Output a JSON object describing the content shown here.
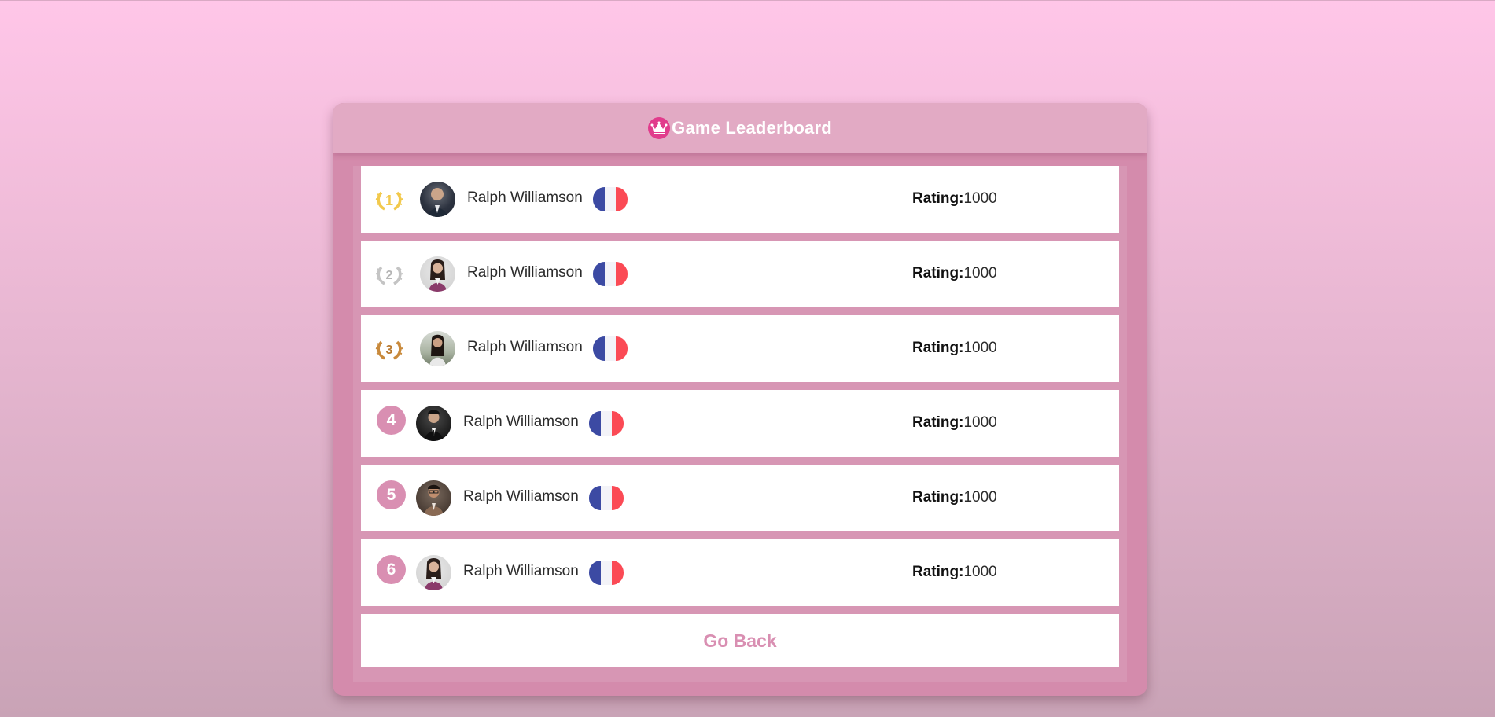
{
  "header": {
    "title": "Game Leaderboard",
    "icon": "crown-icon"
  },
  "rating_label": "Rating:",
  "players": [
    {
      "rank": "1",
      "name": "Ralph Williamson",
      "rating": "1000",
      "badge": "gold-laurel",
      "country": "France",
      "avatar": "avatar-man-suit"
    },
    {
      "rank": "2",
      "name": "Ralph Williamson",
      "rating": "1000",
      "badge": "silver-laurel",
      "country": "France",
      "avatar": "avatar-woman-dark-hair"
    },
    {
      "rank": "3",
      "name": "Ralph Williamson",
      "rating": "1000",
      "badge": "bronze-laurel",
      "country": "France",
      "avatar": "avatar-woman-outdoor"
    },
    {
      "rank": "4",
      "name": "Ralph Williamson",
      "rating": "1000",
      "badge": "number",
      "country": "France",
      "avatar": "avatar-man-dark"
    },
    {
      "rank": "5",
      "name": "Ralph Williamson",
      "rating": "1000",
      "badge": "number",
      "country": "France",
      "avatar": "avatar-man-glasses"
    },
    {
      "rank": "6",
      "name": "Ralph Williamson",
      "rating": "1000",
      "badge": "number",
      "country": "France",
      "avatar": "avatar-woman-dark-hair"
    }
  ],
  "go_back_label": "Go Back",
  "colors": {
    "accent": "#d98fb2",
    "gold": "#f2c94c",
    "silver": "#c4c4c4",
    "bronze": "#c98a3c",
    "flag_blue": "#3c4aa3",
    "flag_white": "#f3f3f8",
    "flag_red": "#fb4a55"
  }
}
